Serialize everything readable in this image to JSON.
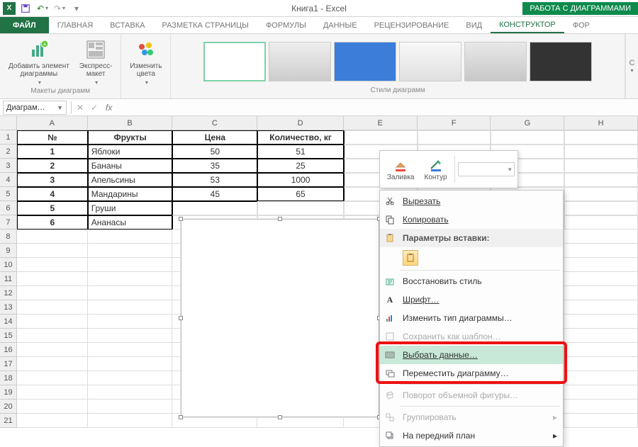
{
  "title": "Книга1 - Excel",
  "tooltab": "РАБОТА С ДИАГРАММАМИ",
  "qat": {
    "undo": "↶",
    "redo": "↷"
  },
  "tabs": {
    "file": "ФАЙЛ",
    "home": "ГЛАВНАЯ",
    "insert": "ВСТАВКА",
    "pagelayout": "РАЗМЕТКА СТРАНИЦЫ",
    "formulas": "ФОРМУЛЫ",
    "data": "ДАННЫЕ",
    "review": "РЕЦЕНЗИРОВАНИЕ",
    "view": "ВИД",
    "design": "КОНСТРУКТОР",
    "format": "ФОР"
  },
  "ribbon": {
    "add_element": "Добавить элемент\nдиаграммы",
    "quick_layout": "Экспресс-\nмакет",
    "group_layout": "Макеты диаграмм",
    "change_colors": "Изменить\nцвета",
    "group_styles": "Стили диаграмм",
    "end": "С"
  },
  "namebox": "Диаграм…",
  "fx": "fx",
  "cancel": "✕",
  "confirm": "✓",
  "cols": [
    "A",
    "B",
    "C",
    "D",
    "E",
    "F",
    "G",
    "H"
  ],
  "table": {
    "headers": [
      "№",
      "Фрукты",
      "Цена",
      "Количество, кг"
    ],
    "rows": [
      [
        "1",
        "Яблоки",
        "50",
        "51"
      ],
      [
        "2",
        "Бананы",
        "35",
        "25"
      ],
      [
        "3",
        "Апельсины",
        "53",
        "1000"
      ],
      [
        "4",
        "Мандарины",
        "45",
        "65"
      ],
      [
        "5",
        "Груши",
        "",
        ""
      ],
      [
        "6",
        "Ананасы",
        "",
        ""
      ]
    ]
  },
  "mini": {
    "fill": "Заливка",
    "outline": "Контур"
  },
  "ctx": {
    "cut": "Вырезать",
    "copy": "Копировать",
    "paste_opts": "Параметры вставки:",
    "reset_style": "Восстановить стиль",
    "font": "Шрифт…",
    "change_chart": "Изменить тип диаграммы…",
    "save_template": "Сохранить как шаблон…",
    "select_data": "Выбрать данные…",
    "move_chart": "Переместить диаграмму…",
    "rotate3d": "Поворот объемной фигуры…",
    "group": "Группировать",
    "bring_front": "На передний план"
  }
}
